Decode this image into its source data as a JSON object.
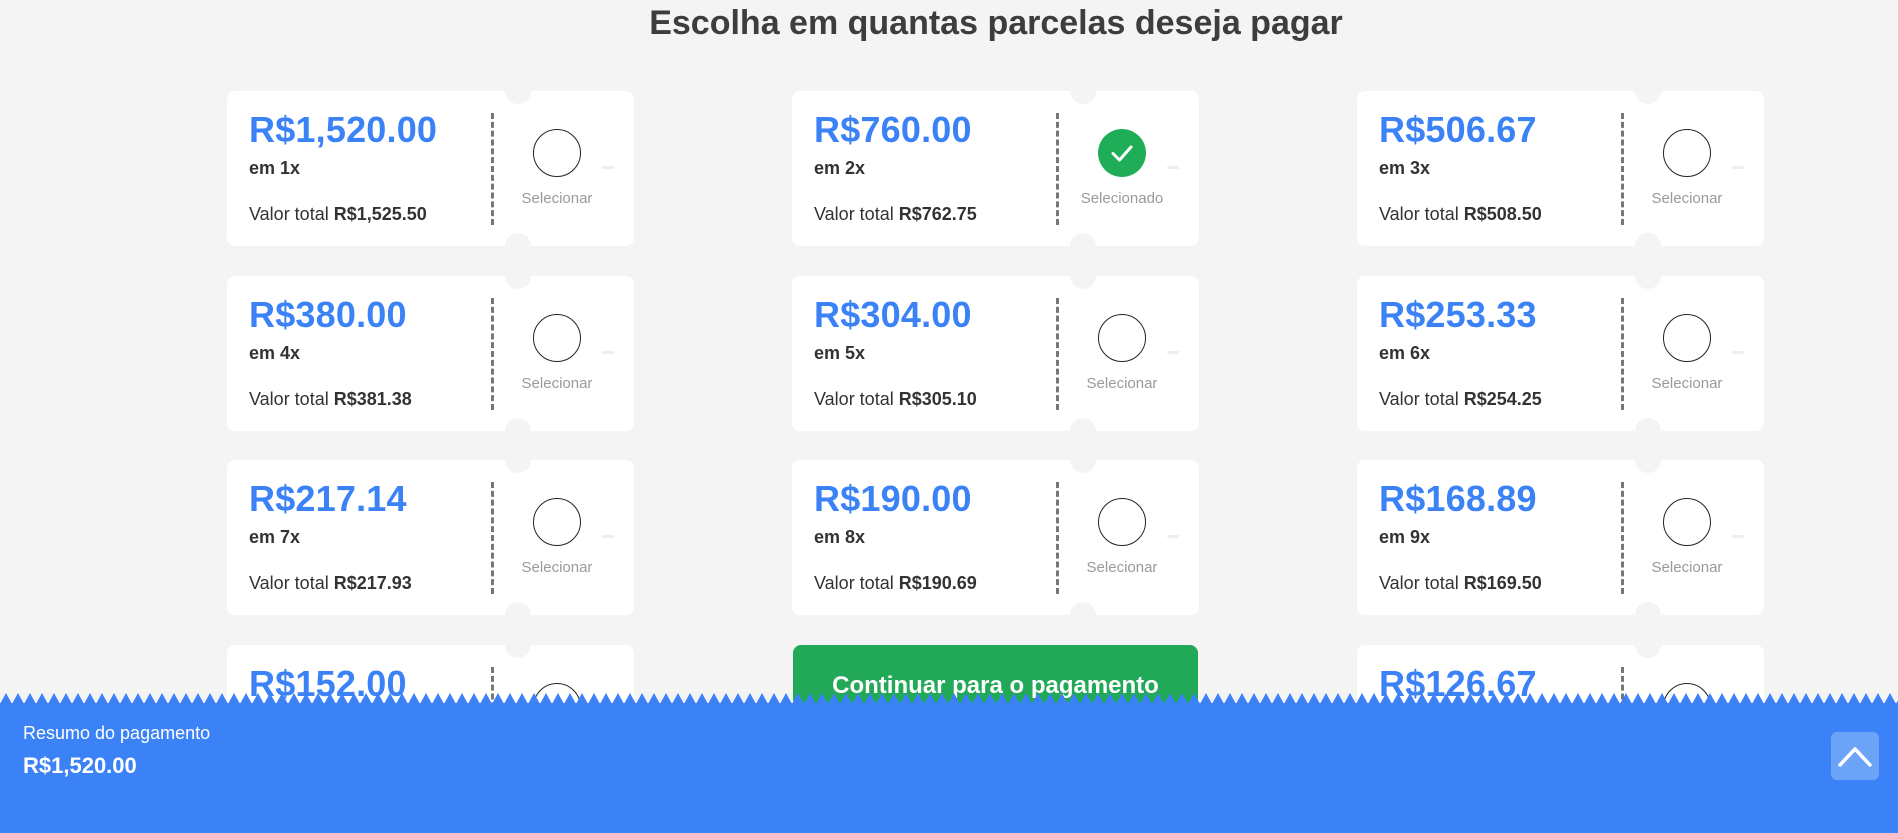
{
  "page": {
    "title": "Escolha em quantas parcelas deseja pagar"
  },
  "options": [
    {
      "amount": "R$1,520.00",
      "count": "em 1x",
      "total_label": "Valor total",
      "total": "R$1,525.50",
      "status": "Selecionar"
    },
    {
      "amount": "R$760.00",
      "count": "em 2x",
      "total_label": "Valor total",
      "total": "R$762.75",
      "status": "Selecionado"
    },
    {
      "amount": "R$506.67",
      "count": "em 3x",
      "total_label": "Valor total",
      "total": "R$508.50",
      "status": "Selecionar"
    },
    {
      "amount": "R$380.00",
      "count": "em 4x",
      "total_label": "Valor total",
      "total": "R$381.38",
      "status": "Selecionar"
    },
    {
      "amount": "R$304.00",
      "count": "em 5x",
      "total_label": "Valor total",
      "total": "R$305.10",
      "status": "Selecionar"
    },
    {
      "amount": "R$253.33",
      "count": "em 6x",
      "total_label": "Valor total",
      "total": "R$254.25",
      "status": "Selecionar"
    },
    {
      "amount": "R$217.14",
      "count": "em 7x",
      "total_label": "Valor total",
      "total": "R$217.93",
      "status": "Selecionar"
    },
    {
      "amount": "R$190.00",
      "count": "em 8x",
      "total_label": "Valor total",
      "total": "R$190.69",
      "status": "Selecionar"
    },
    {
      "amount": "R$168.89",
      "count": "em 9x",
      "total_label": "Valor total",
      "total": "R$169.50",
      "status": "Selecionar"
    },
    {
      "amount": "R$152.00"
    },
    {
      "amount": "R$126.67"
    }
  ],
  "continue_button": {
    "label": "Continuar para o pagamento"
  },
  "summary": {
    "label": "Resumo do pagamento",
    "value": "R$1,520.00"
  },
  "colors": {
    "accent": "#3b82f6",
    "success": "#1fae57",
    "button": "#22a958"
  },
  "icons": {
    "selected": "check-icon",
    "toggle": "chevron-up-icon"
  }
}
